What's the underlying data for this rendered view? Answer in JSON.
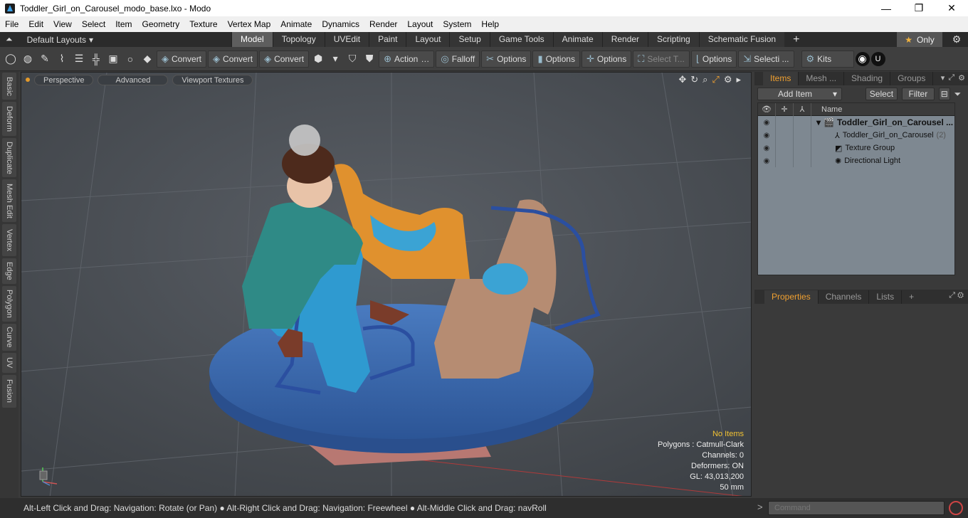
{
  "window": {
    "title": "Toddler_Girl_on_Carousel_modo_base.lxo - Modo",
    "controls": [
      "—",
      "❐",
      "✕"
    ]
  },
  "menu": [
    "File",
    "Edit",
    "View",
    "Select",
    "Item",
    "Geometry",
    "Texture",
    "Vertex Map",
    "Animate",
    "Dynamics",
    "Render",
    "Layout",
    "System",
    "Help"
  ],
  "layout_bar": {
    "layouts_label": "Default Layouts",
    "tabs": [
      "Model",
      "Topology",
      "UVEdit",
      "Paint",
      "Layout",
      "Setup",
      "Game Tools",
      "Animate",
      "Render",
      "Scripting",
      "Schematic Fusion"
    ],
    "active_tab": "Model",
    "only_label": "Only"
  },
  "toolbar": {
    "convert1": "Convert",
    "convert2": "Convert",
    "convert3": "Convert",
    "action": "Action",
    "falloff": "Falloff",
    "options1": "Options",
    "options2": "Options",
    "options3": "Options",
    "select_t": "Select T...",
    "options4": "Options",
    "selecti": "Selecti ...",
    "kits": "Kits"
  },
  "left_tabs": [
    "Basic",
    "Deform",
    "Duplicate",
    "Mesh Edit",
    "Vertex",
    "Edge",
    "Polygon",
    "Curve",
    "UV",
    "Fusion"
  ],
  "viewport": {
    "view_mode": "Perspective",
    "shading": "Advanced",
    "textures": "Viewport Textures",
    "info": {
      "selection": "No Items",
      "polygons": "Polygons : Catmull-Clark",
      "channels": "Channels: 0",
      "deformers": "Deformers: ON",
      "gl": "GL: 43,013,200",
      "unit": "50 mm"
    }
  },
  "items_panel": {
    "tabs": [
      "Items",
      "Mesh ...",
      "Shading",
      "Groups"
    ],
    "active_tab": "Items",
    "add_item": "Add Item",
    "select": "Select",
    "filter": "Filter",
    "column_name": "Name",
    "rows": [
      {
        "label": "Toddler_Girl_on_Carousel ...",
        "bold": true
      },
      {
        "label": "Toddler_Girl_on_Carousel",
        "count": "(2)"
      },
      {
        "label": "Texture Group"
      },
      {
        "label": "Directional Light"
      }
    ]
  },
  "properties_panel": {
    "tabs": [
      "Properties",
      "Channels",
      "Lists"
    ],
    "active_tab": "Properties"
  },
  "status": {
    "message": "Alt-Left Click and Drag: Navigation: Rotate (or Pan) ● Alt-Right Click and Drag: Navigation: Freewheel ● Alt-Middle Click and Drag: navRoll",
    "command_placeholder": "Command"
  },
  "colors": {
    "accent": "#f0a030",
    "viewport_bg": "#4a4f55",
    "carousel_base": "#3b68a8"
  }
}
